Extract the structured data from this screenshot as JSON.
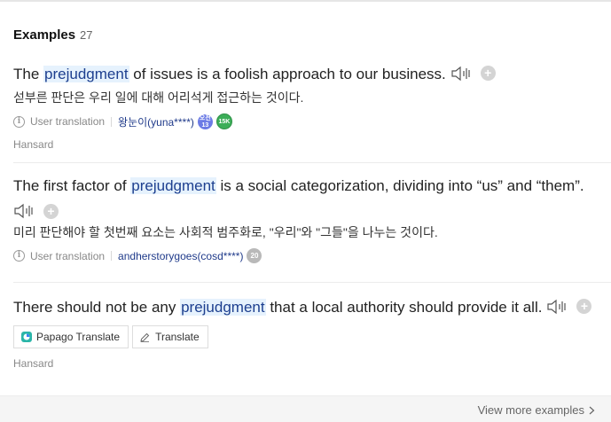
{
  "header": {
    "title": "Examples",
    "count": "27"
  },
  "examples": [
    {
      "pre": "The ",
      "keyword": "prejudgment",
      "post": " of issues is a foolish approach to our business.",
      "translation": "섣부른 판단은 우리 일에 대해 어리석게 접근하는 것이다.",
      "meta_label": "User translation",
      "user": "왕눈이(yuna****)",
      "badge_level": "오전 13",
      "badge_count": "15K",
      "source": "Hansard"
    },
    {
      "pre": "The first factor of ",
      "keyword": "prejudgment",
      "post": " is a social categorization, dividing into “us” and “them”.",
      "translation": "미리 판단해야 할 첫번째 요소는 사회적 범주화로, \"우리\"와 \"그들\"을 나누는 것이다.",
      "meta_label": "User translation",
      "user": "andherstorygoes(cosd****)",
      "badge_count": "20"
    },
    {
      "pre": "There should not be any ",
      "keyword": "prejudgment",
      "post": " that a local authority should provide it all.",
      "buttons": {
        "papago": "Papago Translate",
        "translate": "Translate"
      },
      "source": "Hansard"
    }
  ],
  "footer": {
    "view_more": "View more examples"
  },
  "icons": {
    "speaker": "speaker-icon",
    "add": "plus-circle-icon",
    "info": "info-icon",
    "papago": "papago-logo-icon",
    "pen": "pen-icon",
    "chevron": "chevron-right-icon"
  },
  "colors": {
    "highlight_bg": "#e6f2fd",
    "keyword_text": "#1d3f8f",
    "user_link": "#1f3a8a",
    "badge_blue": "#6c7be5",
    "badge_green": "#3cae58",
    "badge_grey": "#b9b9b9"
  }
}
